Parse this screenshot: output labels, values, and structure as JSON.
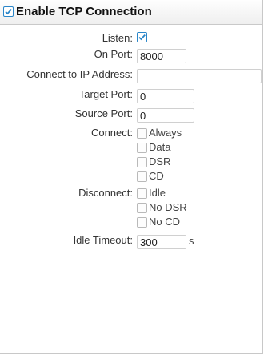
{
  "header": {
    "title": "Enable TCP Connection",
    "enabled": true
  },
  "fields": {
    "listen": {
      "label": "Listen:",
      "checked": true
    },
    "on_port": {
      "label": "On Port:",
      "value": "8000"
    },
    "connect_ip": {
      "label": "Connect to IP Address:",
      "value": ""
    },
    "target_port": {
      "label": "Target Port:",
      "value": "0"
    },
    "source_port": {
      "label": "Source Port:",
      "value": "0"
    },
    "connect": {
      "label": "Connect:",
      "options": [
        {
          "label": "Always",
          "checked": false
        },
        {
          "label": "Data",
          "checked": false
        },
        {
          "label": "DSR",
          "checked": false
        },
        {
          "label": "CD",
          "checked": false
        }
      ]
    },
    "disconnect": {
      "label": "Disconnect:",
      "options": [
        {
          "label": "Idle",
          "checked": false
        },
        {
          "label": "No DSR",
          "checked": false
        },
        {
          "label": "No CD",
          "checked": false
        }
      ]
    },
    "idle_timeout": {
      "label": "Idle Timeout:",
      "value": "300",
      "unit": "s"
    }
  },
  "colors": {
    "accent": "#2a86c9",
    "border": "#c8c8c8"
  }
}
